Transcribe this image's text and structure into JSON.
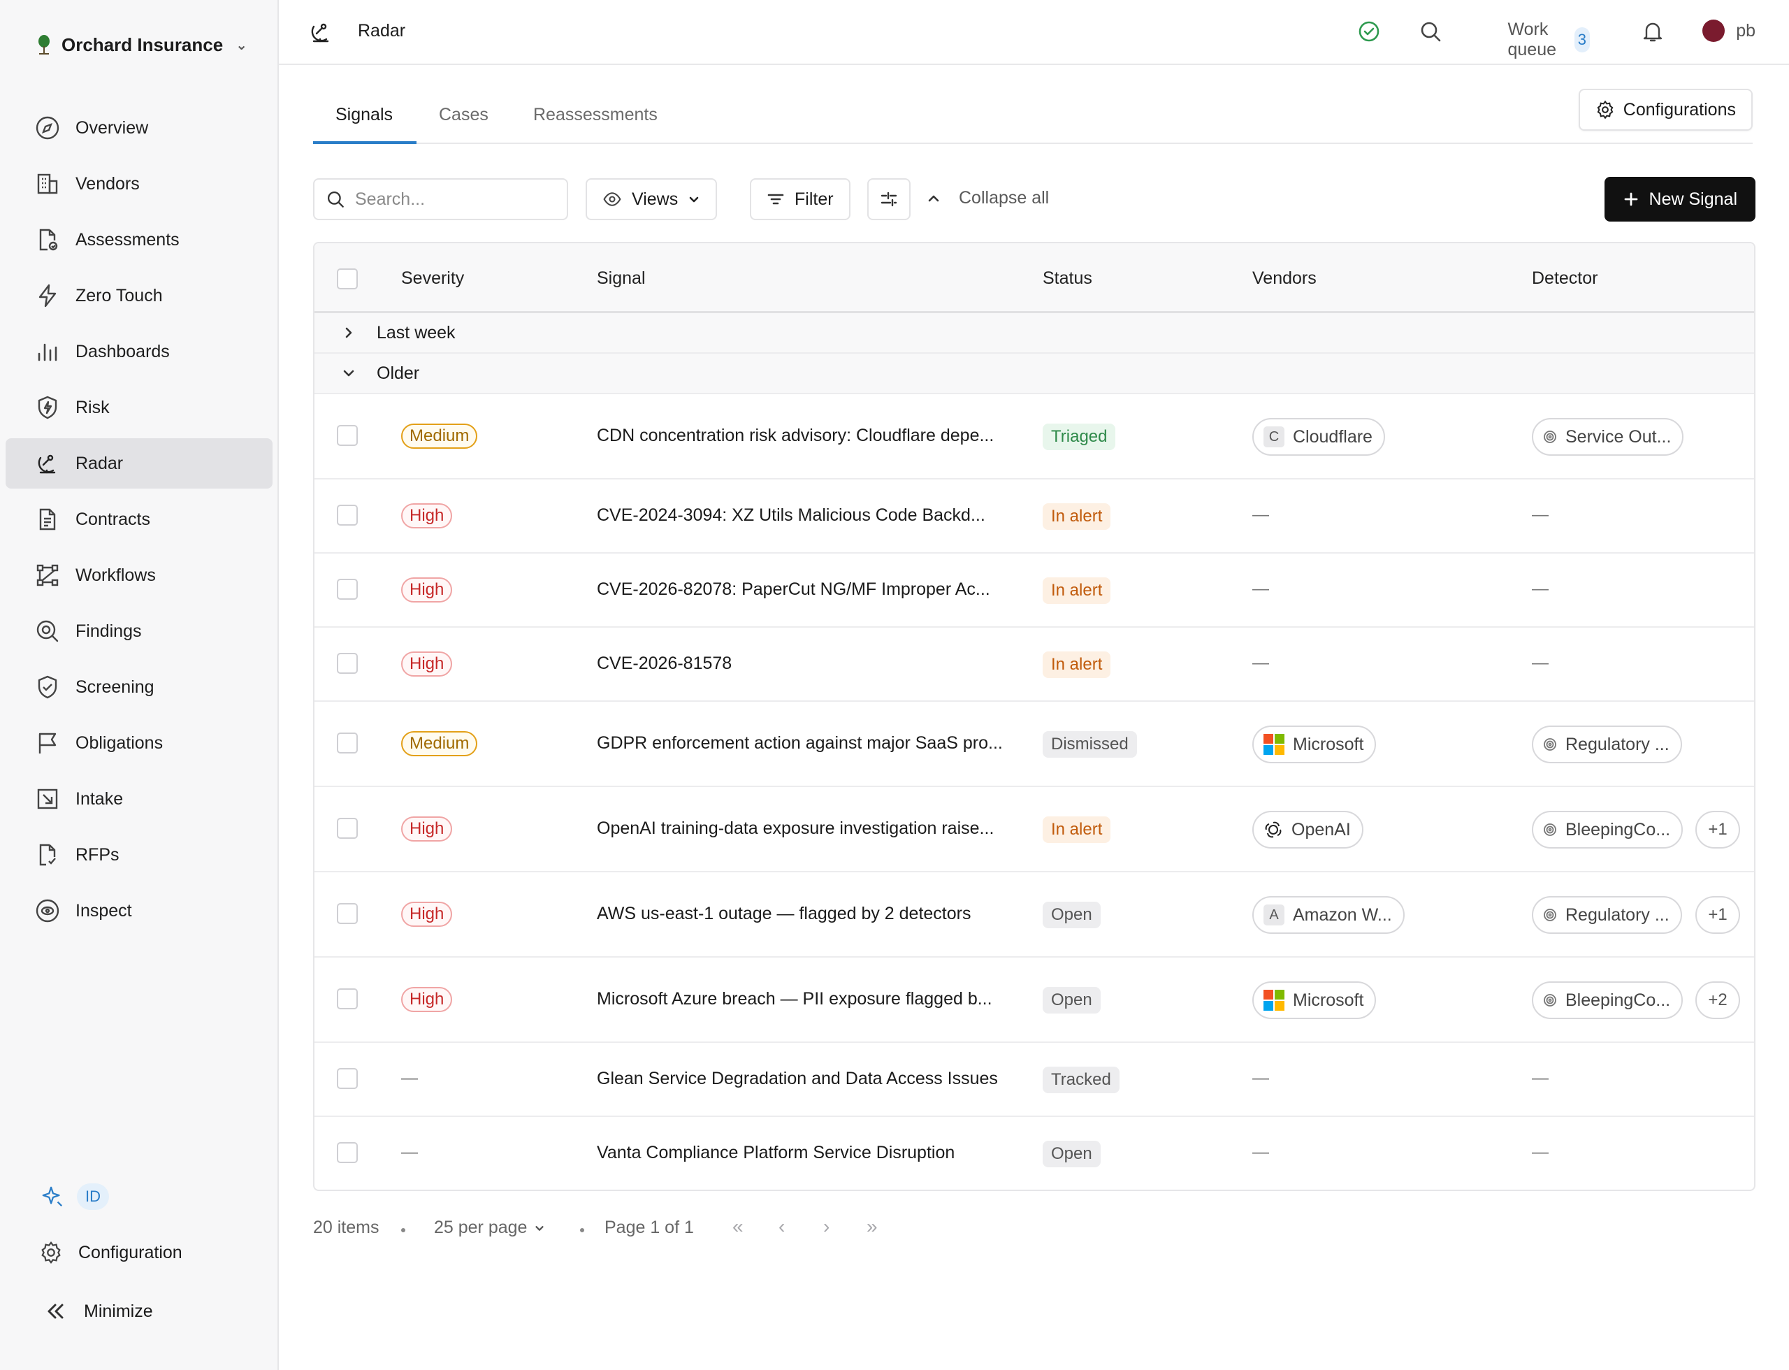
{
  "org": {
    "name": "Orchard Insurance"
  },
  "sidebar": {
    "items": [
      {
        "label": "Overview",
        "icon": "compass-icon"
      },
      {
        "label": "Vendors",
        "icon": "building-icon"
      },
      {
        "label": "Assessments",
        "icon": "document-check-icon"
      },
      {
        "label": "Zero Touch",
        "icon": "lightning-icon"
      },
      {
        "label": "Dashboards",
        "icon": "bar-chart-icon"
      },
      {
        "label": "Risk",
        "icon": "shield-bolt-icon"
      },
      {
        "label": "Radar",
        "icon": "radar-icon",
        "active": true
      },
      {
        "label": "Contracts",
        "icon": "contract-icon"
      },
      {
        "label": "Workflows",
        "icon": "workflow-icon"
      },
      {
        "label": "Findings",
        "icon": "magnify-icon"
      },
      {
        "label": "Screening",
        "icon": "shield-check-icon"
      },
      {
        "label": "Obligations",
        "icon": "flag-icon"
      },
      {
        "label": "Intake",
        "icon": "intake-icon"
      },
      {
        "label": "RFPs",
        "icon": "rfp-doc-icon"
      },
      {
        "label": "Inspect",
        "icon": "eye-icon"
      }
    ],
    "id_badge": "ID",
    "configuration": "Configuration",
    "minimize": "Minimize"
  },
  "topbar": {
    "title": "Radar",
    "work_queue_label": "Work queue",
    "work_queue_count": "3",
    "user_initials": "pb"
  },
  "tabs": [
    "Signals",
    "Cases",
    "Reassessments"
  ],
  "configurations_label": "Configurations",
  "toolbar": {
    "search_placeholder": "Search...",
    "views_label": "Views",
    "filter_label": "Filter",
    "collapse_all_label": "Collapse all",
    "new_signal_label": "New Signal"
  },
  "table": {
    "columns": [
      "Severity",
      "Signal",
      "Status",
      "Vendors",
      "Detector"
    ],
    "groups": [
      {
        "label": "Last week",
        "expanded": false
      },
      {
        "label": "Older",
        "expanded": true
      }
    ],
    "rows": [
      {
        "severity": "Medium",
        "signal": "CDN concentration risk advisory: Cloudflare depe...",
        "status": "Triaged",
        "vendor": "Cloudflare",
        "vendor_letter": "C",
        "detector": "Service Out...",
        "extra": ""
      },
      {
        "severity": "High",
        "signal": "CVE-2024-3094: XZ Utils Malicious Code Backd...",
        "status": "In alert",
        "vendor": "—",
        "vendor_letter": "",
        "detector": "—",
        "extra": ""
      },
      {
        "severity": "High",
        "signal": "CVE-2026-82078: PaperCut NG/MF Improper Ac...",
        "status": "In alert",
        "vendor": "—",
        "vendor_letter": "",
        "detector": "—",
        "extra": ""
      },
      {
        "severity": "High",
        "signal": "CVE-2026-81578",
        "status": "In alert",
        "vendor": "—",
        "vendor_letter": "",
        "detector": "—",
        "extra": ""
      },
      {
        "severity": "Medium",
        "signal": "GDPR enforcement action against major SaaS pro...",
        "status": "Dismissed",
        "vendor": "Microsoft",
        "vendor_letter": "",
        "detector": "Regulatory ...",
        "extra": ""
      },
      {
        "severity": "High",
        "signal": "OpenAI training-data exposure investigation raise...",
        "status": "In alert",
        "vendor": "OpenAI",
        "vendor_letter": "",
        "detector": "BleepingCo...",
        "extra": "+1"
      },
      {
        "severity": "High",
        "signal": "AWS us-east-1 outage — flagged by 2 detectors",
        "status": "Open",
        "vendor": "Amazon W...",
        "vendor_letter": "A",
        "detector": "Regulatory ...",
        "extra": "+1"
      },
      {
        "severity": "High",
        "signal": "Microsoft Azure breach — PII exposure flagged b...",
        "status": "Open",
        "vendor": "Microsoft",
        "vendor_letter": "",
        "detector": "BleepingCo...",
        "extra": "+2"
      },
      {
        "severity": "—",
        "signal": "Glean Service Degradation and Data Access Issues",
        "status": "Tracked",
        "vendor": "—",
        "vendor_letter": "",
        "detector": "—",
        "extra": ""
      },
      {
        "severity": "—",
        "signal": "Vanta Compliance Platform Service Disruption",
        "status": "Open",
        "vendor": "—",
        "vendor_letter": "",
        "detector": "—",
        "extra": ""
      }
    ]
  },
  "pagination": {
    "items": "20 items",
    "per_page": "25 per page",
    "page": "Page 1 of 1"
  },
  "colors": {
    "accent": "#2a7dc8",
    "medium_border": "#e3a018",
    "high_text": "#c62828",
    "triaged_text": "#2f8a4a",
    "in_alert_text": "#c15b0c",
    "primary_button": "#111111"
  }
}
